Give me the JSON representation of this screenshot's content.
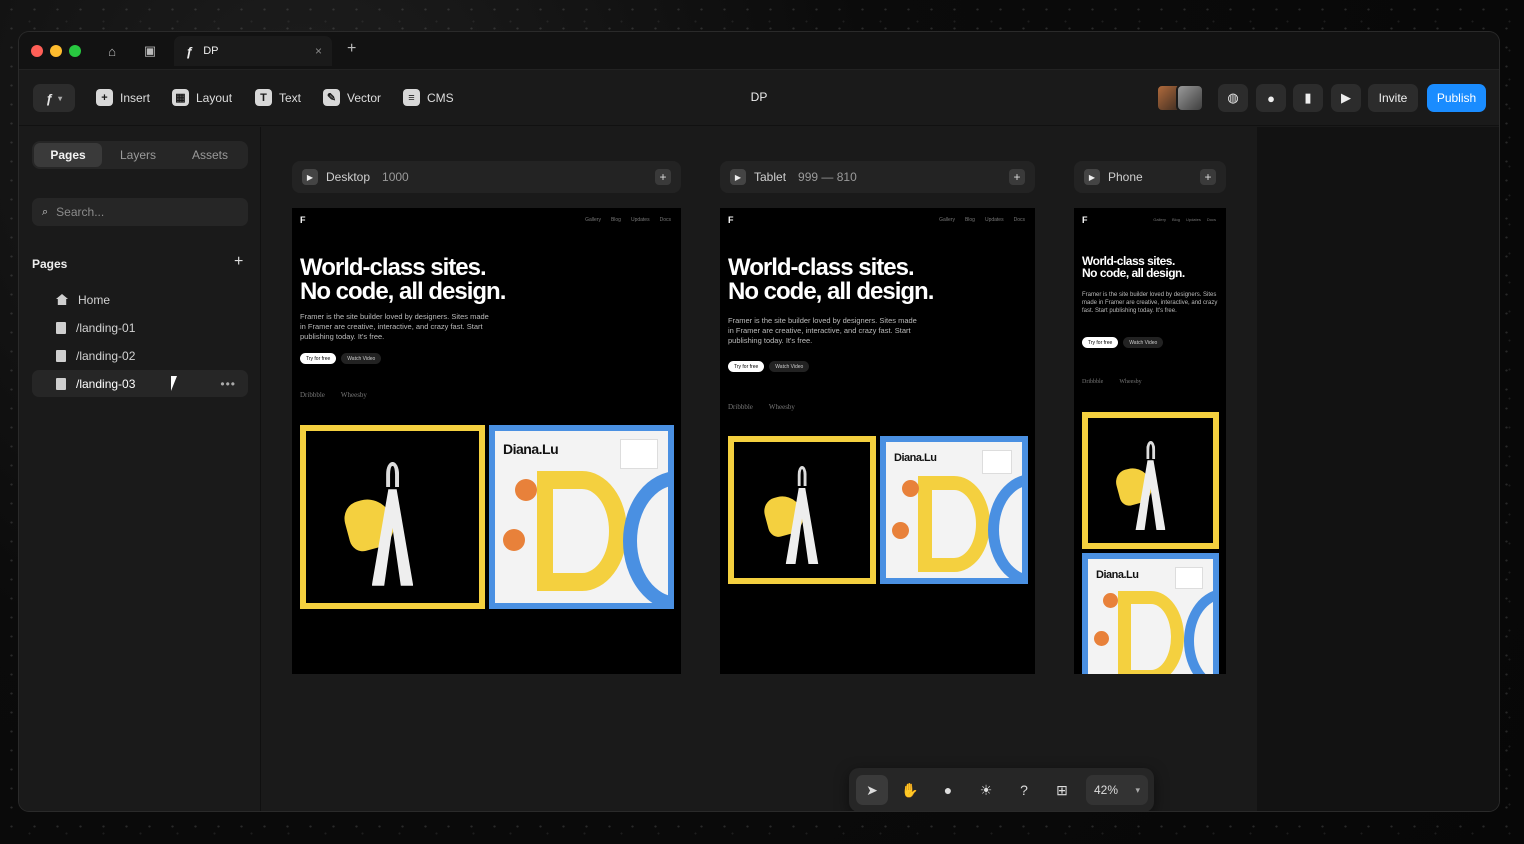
{
  "titlebar": {
    "tab_label": "DP",
    "tab_close": "×",
    "new_tab": "+"
  },
  "toolbar": {
    "insert": "Insert",
    "layout": "Layout",
    "text": "Text",
    "vector": "Vector",
    "cms": "CMS",
    "doc_title": "DP",
    "invite": "Invite",
    "publish": "Publish"
  },
  "sidebar": {
    "tabs": [
      "Pages",
      "Layers",
      "Assets"
    ],
    "search_placeholder": "Search...",
    "section_title": "Pages",
    "section_add": "+",
    "pages": [
      {
        "label": "Home"
      },
      {
        "label": "/landing-01"
      },
      {
        "label": "/landing-02"
      },
      {
        "label": "/landing-03"
      }
    ],
    "more": "•••"
  },
  "breakpoints": [
    {
      "name": "Desktop",
      "size": "1000",
      "add": "+"
    },
    {
      "name": "Tablet",
      "size": "999 — 810",
      "add": "+"
    },
    {
      "name": "Phone",
      "size": "",
      "add": "+"
    }
  ],
  "preview": {
    "logo": "F",
    "nav": [
      "Gallery",
      "Blog",
      "Updates",
      "Docs"
    ],
    "hero_line1": "World-class sites.",
    "hero_line2": "No code, all design.",
    "desc": "Framer is the site builder loved by designers. Sites made in Framer are creative, interactive, and crazy fast. Start publishing today. It's free.",
    "btn_primary": "Try for free",
    "btn_secondary": "Watch Video",
    "logo_a": "Dribbble",
    "logo_b": "Wheesby",
    "card_title": "Diana.Lu"
  },
  "bottombar": {
    "zoom": "42%"
  },
  "colors": {
    "accent": "#1a8cff",
    "card_yellow": "#f4d03f",
    "card_blue": "#4a90e2"
  }
}
